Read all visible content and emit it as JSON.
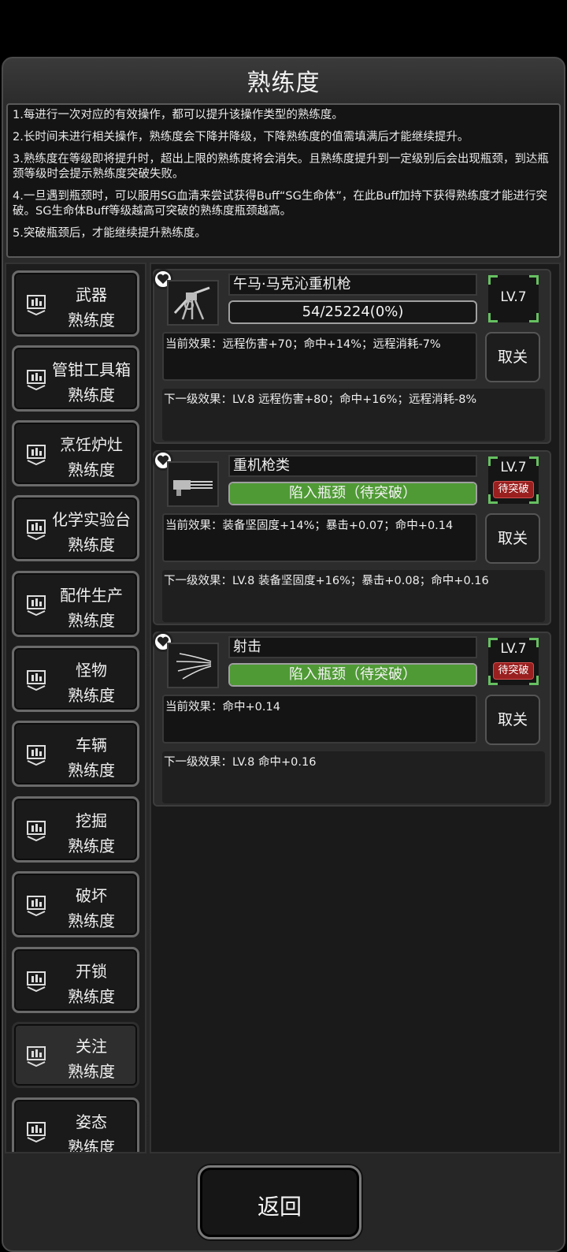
{
  "header": {
    "title": "熟练度"
  },
  "info": [
    "1.每进行一次对应的有效操作，都可以提升该操作类型的熟练度。",
    "2.长时间未进行相关操作，熟练度会下降并降级，下降熟练度的值需填满后才能继续提升。",
    "3.熟练度在等级即将提升时，超出上限的熟练度将会消失。且熟练度提升到一定级别后会出现瓶颈，到达瓶颈等级时会提示熟练度突破失败。",
    "4.一旦遇到瓶颈时，可以服用SG血清来尝试获得Buff“SG生命体”，在此Buff加持下获得熟练度才能进行突破。SG生命体Buff等级越高可突破的熟练度瓶颈越高。",
    "5.突破瓶颈后，才能继续提升熟练度。"
  ],
  "categories": [
    {
      "l1": "武器",
      "l2": "熟练度"
    },
    {
      "l1": "管钳工具箱",
      "l2": "熟练度"
    },
    {
      "l1": "烹饪炉灶",
      "l2": "熟练度"
    },
    {
      "l1": "化学实验台",
      "l2": "熟练度"
    },
    {
      "l1": "配件生产",
      "l2": "熟练度"
    },
    {
      "l1": "怪物",
      "l2": "熟练度"
    },
    {
      "l1": "车辆",
      "l2": "熟练度"
    },
    {
      "l1": "挖掘",
      "l2": "熟练度"
    },
    {
      "l1": "破坏",
      "l2": "熟练度"
    },
    {
      "l1": "开锁",
      "l2": "熟练度"
    },
    {
      "l1": "关注",
      "l2": "熟练度"
    },
    {
      "l1": "姿态",
      "l2": "熟练度"
    }
  ],
  "skills": [
    {
      "name": "午马·马克沁重机枪",
      "progress": "54/25224(0%)",
      "fill": 0.0,
      "level": "LV.7",
      "badge": "",
      "current": "当前效果：远程伤害+70；命中+14%；远程消耗-7%",
      "next": "下一级效果：LV.8 远程伤害+80；命中+16%；远程消耗-8%",
      "button": "取关"
    },
    {
      "name": "重机枪类",
      "progress": "陷入瓶颈（待突破）",
      "fill": 1.0,
      "level": "LV.7",
      "badge": "待突破",
      "current": "当前效果：装备坚固度+14%；暴击+0.07；命中+0.14",
      "next": "下一级效果：LV.8 装备坚固度+16%；暴击+0.08；命中+0.16",
      "button": "取关"
    },
    {
      "name": "射击",
      "progress": "陷入瓶颈（待突破）",
      "fill": 1.0,
      "level": "LV.7",
      "badge": "待突破",
      "current": "当前效果：命中+0.14",
      "next": "下一级效果：LV.8 命中+0.16",
      "button": "取关"
    }
  ],
  "footer": {
    "back_label": "返回"
  },
  "colors": {
    "progress_fill": "#4f9a35",
    "level_corner": "#66c061",
    "badge": "#9a1f1f"
  }
}
